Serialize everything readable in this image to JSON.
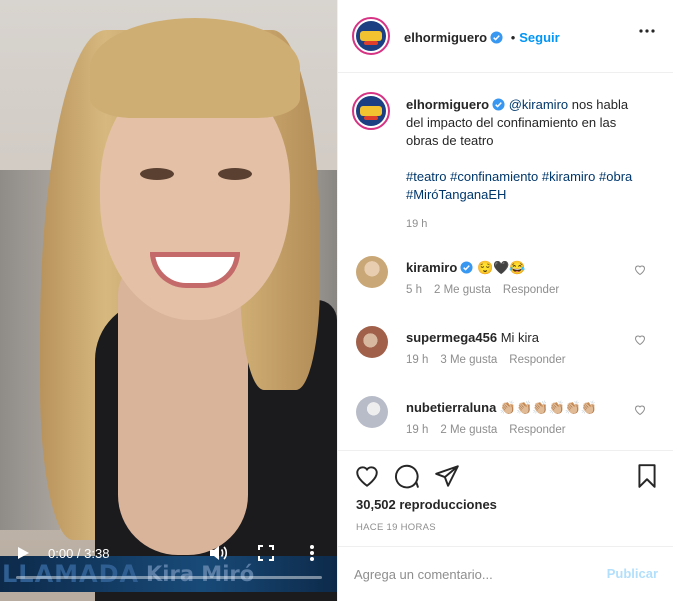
{
  "video": {
    "lower_third_left": "LLAMADA",
    "lower_third_right": "Kira Miró",
    "time": "0:00 / 3:38",
    "progress": 0.0
  },
  "header": {
    "username": "elhormiguero",
    "dot": "•",
    "follow_label": "Seguir"
  },
  "caption": {
    "username": "elhormiguero",
    "mention": "@kiramiro",
    "text": " nos habla del impacto del confinamiento en las obras de teatro",
    "hashtags": [
      "#teatro",
      "#confinamiento",
      "#kiramiro",
      "#obra",
      "#MiróTanganaEH"
    ],
    "time": "19 h"
  },
  "comments": [
    {
      "username": "kiramiro",
      "verified": true,
      "text": "😌🖤😂",
      "time": "5 h",
      "likes": "2 Me gusta",
      "reply": "Responder",
      "avatar_color": "#c9a776"
    },
    {
      "username": "supermega456",
      "verified": false,
      "text": "Mi kira",
      "time": "19 h",
      "likes": "3 Me gusta",
      "reply": "Responder",
      "avatar_color": "#a0604a"
    },
    {
      "username": "nubetierraluna",
      "verified": false,
      "text": "👏🏼👏🏼👏🏼👏🏼👏🏼👏🏼",
      "time": "19 h",
      "likes": "2 Me gusta",
      "reply": "Responder",
      "avatar_color": "#b8bcc8"
    }
  ],
  "actions": {
    "views": "30,502 reproducciones",
    "posted": "HACE 19 HORAS"
  },
  "add_comment": {
    "placeholder": "Agrega un comentario...",
    "publish_label": "Publicar"
  },
  "colors": {
    "accent": "#0095f6",
    "link": "#00376b",
    "muted": "#8e8e8e",
    "publish_disabled": "#b2dffc"
  }
}
